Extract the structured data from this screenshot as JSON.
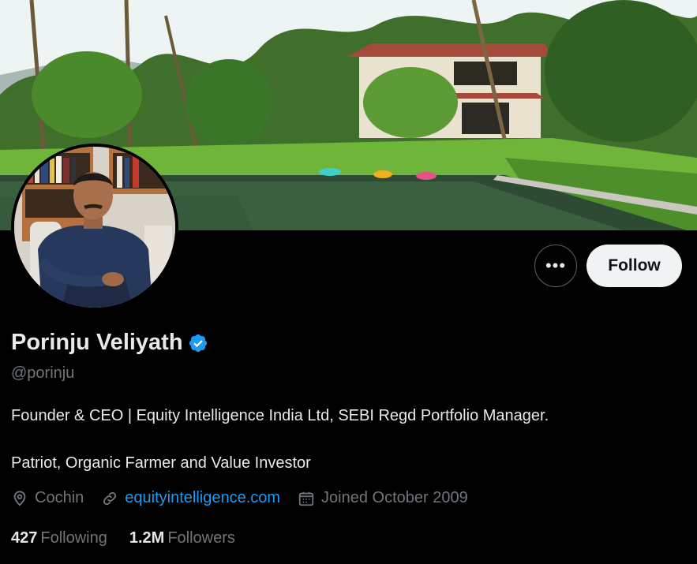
{
  "profile": {
    "display_name": "Porinju Veliyath",
    "handle": "@porinju",
    "bio_line1": "Founder & CEO | Equity Intelligence India Ltd, SEBI Regd Portfolio Manager.",
    "bio_line2": "Patriot, Organic Farmer and Value Investor",
    "location": "Cochin",
    "website": "equityintelligence.com",
    "joined": "Joined October 2009",
    "following_count": "427",
    "following_label": "Following",
    "followers_count": "1.2M",
    "followers_label": "Followers"
  },
  "actions": {
    "more_label": "•••",
    "follow_label": "Follow"
  },
  "icons": {
    "verified": "verified-badge-icon",
    "location": "location-pin-icon",
    "link": "link-icon",
    "calendar": "calendar-icon"
  },
  "colors": {
    "background": "#000000",
    "text_primary": "#e7e9ea",
    "text_secondary": "#71767b",
    "link": "#1d9bf0",
    "verified": "#1d9bf0",
    "follow_bg": "#eff3f4"
  }
}
